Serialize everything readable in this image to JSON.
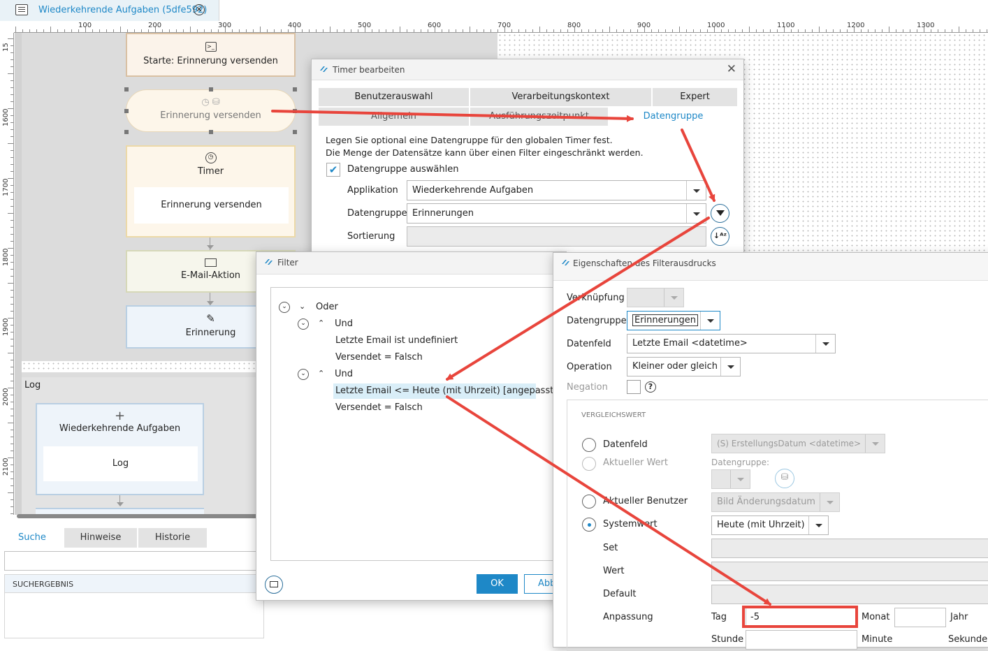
{
  "document_tab": {
    "title": "Wiederkehrende Aufgaben (5dfe592)"
  },
  "ruler": {
    "h_labels": [
      "100",
      "200",
      "300",
      "400",
      "500",
      "600",
      "700",
      "800",
      "900",
      "1000",
      "1100",
      "1200",
      "1300"
    ],
    "v_labels": [
      "15",
      "1600",
      "1700",
      "1800",
      "1900",
      "2000",
      "2100"
    ]
  },
  "canvas": {
    "start_node": "Starte: Erinnerung versenden",
    "ghost_node": "Erinnerung versenden",
    "timer_node": {
      "title": "Timer",
      "inner": "Erinnerung versenden"
    },
    "email_node": "E-Mail-Aktion",
    "erinnerung_node": "Erinnerung",
    "log_lane": "Log",
    "wiederkehrende_node": {
      "title": "Wiederkehrende Aufgaben",
      "inner": "Log"
    }
  },
  "bottom_panel": {
    "tabs": [
      "Suche",
      "Hinweise",
      "Historie"
    ],
    "search_result_header": "SUCHERGEBNIS"
  },
  "timer_dialog": {
    "title": "Timer bearbeiten",
    "tabs_row1": [
      "Benutzerauswahl",
      "Verarbeitungskontext",
      "Expert"
    ],
    "tabs_row2": [
      "Allgemein",
      "Ausführungszeitpunkt",
      "Datengruppe"
    ],
    "description_line1": "Legen Sie optional eine Datengruppe für den globalen Timer fest.",
    "description_line2": "Die Menge der Datensätze kann über einen Filter eingeschränkt werden.",
    "checkbox_label": "Datengruppe auswählen",
    "applikation_label": "Applikation",
    "applikation_value": "Wiederkehrende Aufgaben",
    "datengruppe_label": "Datengruppe",
    "datengruppe_value": "Erinnerungen",
    "sortierung_label": "Sortierung"
  },
  "filter_dialog": {
    "title": "Filter",
    "tree": {
      "root": "Oder",
      "group1": "Und",
      "g1_items": [
        "Letzte Email ist undefiniert",
        "Versendet = Falsch"
      ],
      "group2": "Und",
      "g2_items": [
        "Letzte Email <= Heute (mit Uhrzeit) [angepasst]",
        "Versendet = Falsch"
      ]
    },
    "ok_label": "OK",
    "cancel_label": "Abb"
  },
  "props_dialog": {
    "title": "Eigenschaften des Filterausdrucks",
    "verknuepfung_label": "Verknüpfung",
    "datengruppe_label": "Datengruppe",
    "datengruppe_value": "Erinnerungen",
    "datenfeld_label": "Datenfeld",
    "datenfeld_value": "Letzte Email <datetime>",
    "operation_label": "Operation",
    "operation_value": "Kleiner oder gleich",
    "negation_label": "Negation",
    "section_title": "VERGLEICHSWERT",
    "radio_datenfeld": "Datenfeld",
    "radio_datenfeld_value": "(S) ErstellungsDatum <datetime>",
    "radio_aktueller_wert": "Aktueller Wert",
    "datengruppe_sub_label": "Datengruppe:",
    "radio_aktueller_benutzer": "Aktueller Benutzer",
    "aktueller_benutzer_value": "Bild Änderungsdatum",
    "radio_systemwert": "Systemwert",
    "systemwert_value": "Heute (mit Uhrzeit)",
    "set_label": "Set",
    "wert_label": "Wert",
    "default_label": "Default",
    "anpassung_label": "Anpassung",
    "tag_label": "Tag",
    "tag_value": "-5",
    "monat_label": "Monat",
    "jahr_label": "Jahr",
    "stunde_label": "Stunde",
    "minute_label": "Minute",
    "sekunde_label": "Sekunde"
  },
  "colors": {
    "accent": "#1e88c7",
    "annotation": "#e8453c"
  }
}
